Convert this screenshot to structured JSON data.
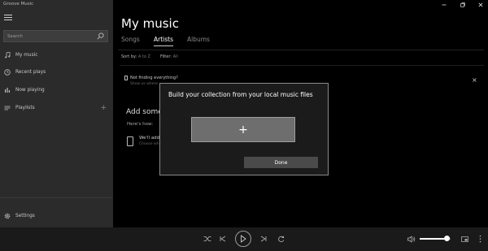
{
  "app": {
    "title": "Groove Music"
  },
  "sidebar": {
    "search_placeholder": "Search",
    "items": [
      {
        "label": "My music",
        "icon": "music-note-icon"
      },
      {
        "label": "Recent plays",
        "icon": "clock-icon"
      },
      {
        "label": "Now playing",
        "icon": "equalizer-icon"
      },
      {
        "label": "Playlists",
        "icon": "list-icon",
        "add_icon": "plus-icon"
      }
    ],
    "settings_label": "Settings"
  },
  "main": {
    "title": "My music",
    "tabs": [
      {
        "label": "Songs",
        "active": false
      },
      {
        "label": "Artists",
        "active": true
      },
      {
        "label": "Albums",
        "active": false
      }
    ],
    "sort_label": "Sort by:",
    "sort_value": "A to Z",
    "filter_label": "Filter:",
    "filter_value": "All",
    "banner_title": "Not finding everything?",
    "banner_sub": "Show us where",
    "add_heading": "Add some",
    "heres_how": "Here's how:",
    "step_title": "We'll add",
    "step_sub": "Choose wher"
  },
  "dialog": {
    "title": "Build your collection from your local music files",
    "add_glyph": "+",
    "done_label": "Done"
  },
  "player": {
    "controls": [
      "shuffle-icon",
      "previous-icon",
      "play-icon",
      "next-icon",
      "repeat-icon"
    ],
    "volume_level": 0.85
  },
  "colors": {
    "sidebar": "#2b2b2b",
    "dialog": "#1b1b1b",
    "add_button": "#6e6e6e",
    "done_button": "#4a4a4a"
  }
}
